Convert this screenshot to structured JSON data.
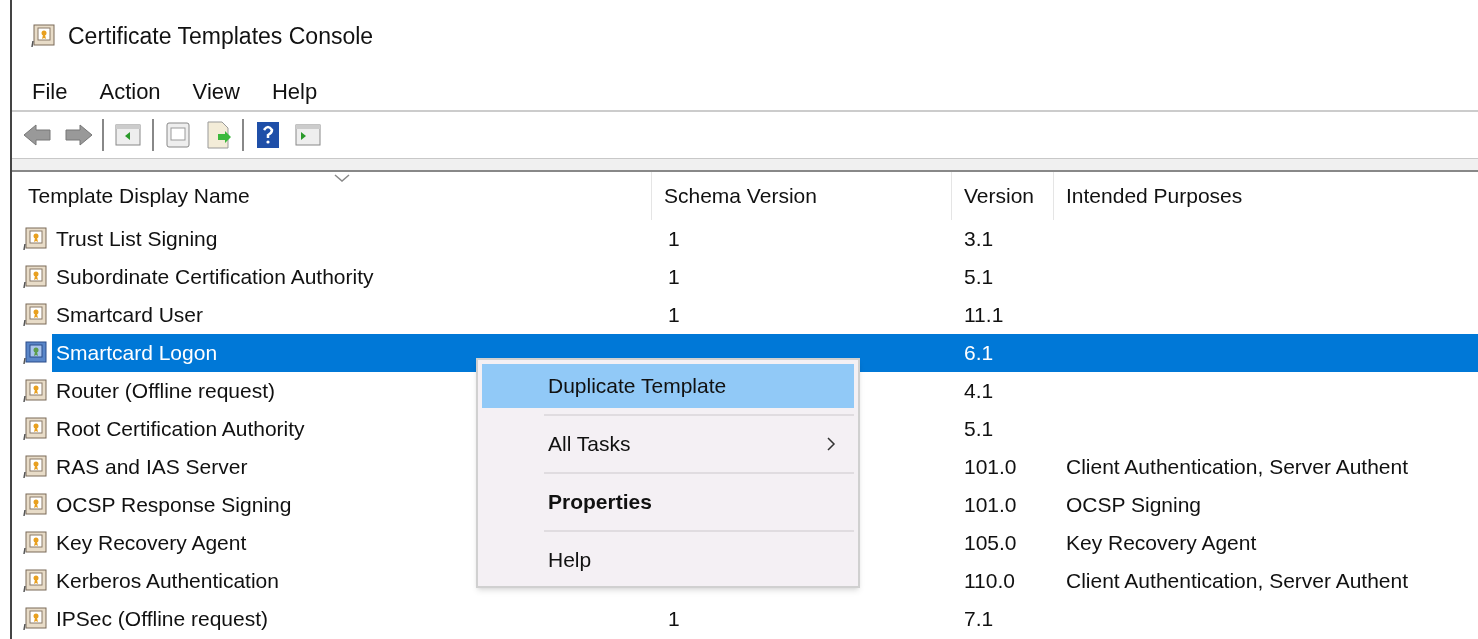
{
  "window": {
    "title": "Certificate Templates Console"
  },
  "menu_bar": [
    "File",
    "Action",
    "View",
    "Help"
  ],
  "table": {
    "columns": [
      "Template Display Name",
      "Schema Version",
      "Version",
      "Intended Purposes"
    ],
    "rows": [
      {
        "name": "Trust List Signing",
        "schema_version": "1",
        "version": "3.1",
        "selected": false
      },
      {
        "name": "Subordinate Certification Authority",
        "schema_version": "1",
        "version": "5.1",
        "selected": false
      },
      {
        "name": "Smartcard User",
        "schema_version": "1",
        "version": "11.1",
        "selected": false
      },
      {
        "name": "Smartcard Logon",
        "version": "6.1",
        "selected": true
      },
      {
        "name": "Router (Offline request)",
        "version": "4.1",
        "selected": false
      },
      {
        "name": "Root Certification Authority",
        "version": "5.1",
        "selected": false
      },
      {
        "name": "RAS and IAS Server",
        "version": "101.0",
        "purposes": "Client Authentication, Server Authent",
        "selected": false
      },
      {
        "name": "OCSP Response Signing",
        "version": "101.0",
        "purposes": "OCSP Signing",
        "selected": false
      },
      {
        "name": "Key Recovery Agent",
        "version": "105.0",
        "purposes": "Key Recovery Agent",
        "selected": false
      },
      {
        "name": "Kerberos Authentication",
        "version": "110.0",
        "purposes": "Client Authentication, Server Authent",
        "selected": false
      },
      {
        "name": "IPSec (Offline request)",
        "schema_version": "1",
        "version": "7.1",
        "selected": false
      }
    ]
  },
  "context_menu": {
    "items": [
      {
        "label": "Duplicate Template",
        "selected": true,
        "bold": false,
        "submenu": false
      },
      {
        "label": "All Tasks",
        "selected": false,
        "bold": false,
        "submenu": true
      },
      {
        "label": "Properties",
        "selected": false,
        "bold": true,
        "submenu": false
      },
      {
        "label": "Help",
        "selected": false,
        "bold": false,
        "submenu": false
      }
    ]
  }
}
